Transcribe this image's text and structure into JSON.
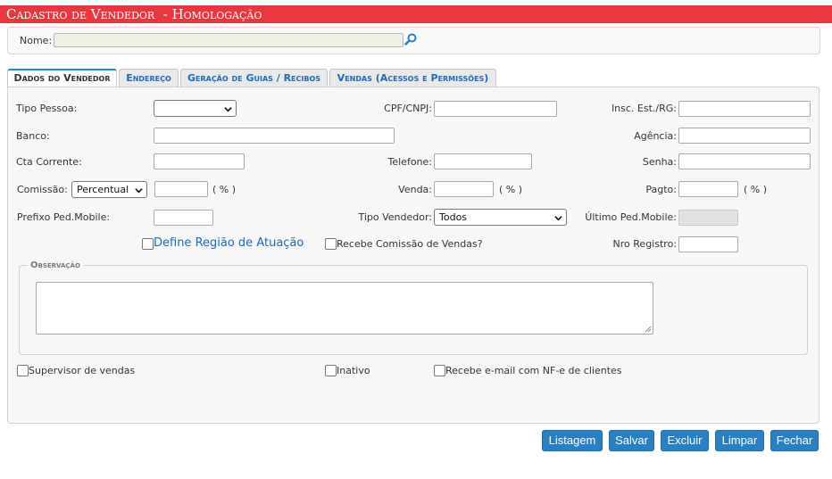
{
  "title": "Cadastro de Vendedor  - Homologação",
  "name_section": {
    "label": "Nome:",
    "value": "",
    "search_icon": "search-icon"
  },
  "tabs": [
    {
      "label": "Dados do Vendedor",
      "active": true
    },
    {
      "label": "Endereço",
      "active": false
    },
    {
      "label": "Geração de Guias / Recibos",
      "active": false
    },
    {
      "label": "Vendas (Acessos e Permissões)",
      "active": false
    }
  ],
  "form": {
    "tipo_pessoa_label": "Tipo Pessoa:",
    "tipo_pessoa_value": "",
    "cpf_label": "CPF/CNPJ:",
    "cpf_value": "",
    "insc_label": "Insc. Est./RG:",
    "insc_value": "",
    "banco_label": "Banco:",
    "banco_value": "",
    "agencia_label": "Agência:",
    "agencia_value": "",
    "cta_label": "Cta Corrente:",
    "cta_value": "",
    "telefone_label": "Telefone:",
    "telefone_value": "",
    "senha_label": "Senha:",
    "senha_value": "",
    "comissao_label": "Comissão:",
    "comissao_type": "Percentual",
    "comissao_value": "",
    "comissao_unit": "( % )",
    "venda_label": "Venda:",
    "venda_value": "",
    "venda_unit": "( % )",
    "pagto_label": "Pagto:",
    "pagto_value": "",
    "pagto_unit": "( % )",
    "prefixo_label": "Prefixo Ped.Mobile:",
    "prefixo_value": "",
    "tipo_vendedor_label": "Tipo Vendedor:",
    "tipo_vendedor_value": "Todos",
    "ultimo_label": "Último Ped.Mobile:",
    "ultimo_value": "",
    "define_regiao_label": "Define Região de Atuação",
    "define_regiao_checked": false,
    "recebe_comissao_label": "Recebe Comissão de Vendas?",
    "recebe_comissao_checked": false,
    "nro_registro_label": "Nro Registro:",
    "nro_registro_value": ""
  },
  "observacao": {
    "legend": "Observação",
    "value": ""
  },
  "checkboxes": {
    "supervisor_label": "Supervisor de vendas",
    "inativo_label": "Inativo",
    "recebe_email_label": "Recebe e-mail com NF-e de clientes"
  },
  "buttons": {
    "listagem": "Listagem",
    "salvar": "Salvar",
    "excluir": "Excluir",
    "limpar": "Limpar",
    "fechar": "Fechar"
  },
  "colors": {
    "title_bar": "#e8383f",
    "button": "#2a7fc1",
    "link": "#2168b5"
  }
}
